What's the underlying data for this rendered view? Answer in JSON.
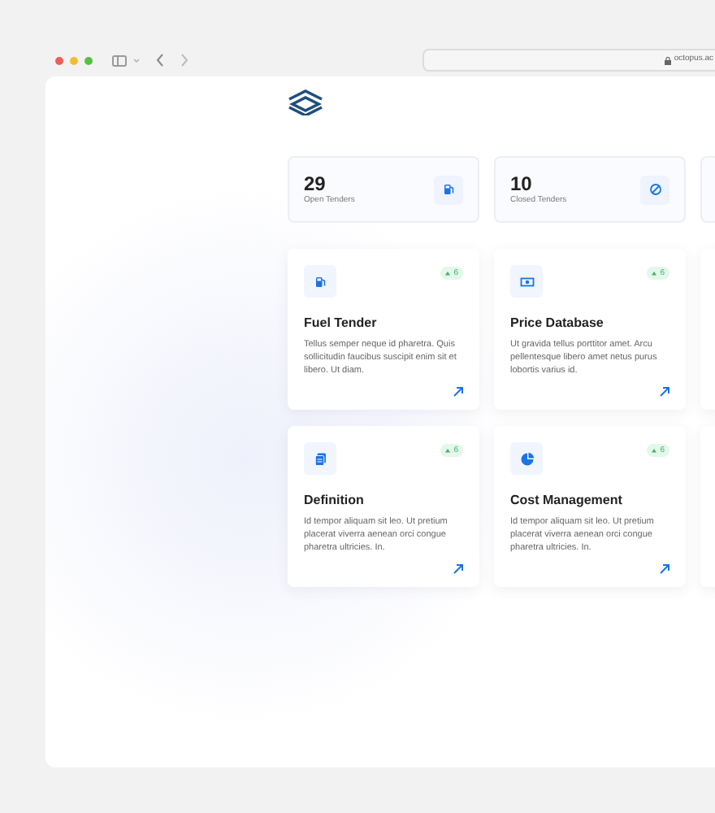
{
  "browser": {
    "address": "octopus.ac"
  },
  "stats": [
    {
      "value": "29",
      "label": "Open Tenders"
    },
    {
      "value": "10",
      "label": "Closed Tenders"
    }
  ],
  "modules": [
    {
      "title": "Fuel Tender",
      "description": "Tellus semper neque id pharetra. Quis sollicitudin faucibus suscipit enim sit et libero. Ut diam.",
      "badge": "6"
    },
    {
      "title": "Price Database",
      "description": "Ut gravida tellus porttitor amet. Arcu pellentesque libero amet netus purus lobortis varius id.",
      "badge": "6"
    },
    {
      "title": "Definition",
      "description": "Id tempor aliquam sit leo. Ut pretium placerat viverra aenean orci congue pharetra ultricies. In.",
      "badge": "6"
    },
    {
      "title": "Cost Management",
      "description": "Id tempor aliquam sit leo. Ut pretium placerat viverra aenean orci congue pharetra ultricies. In.",
      "badge": "6"
    }
  ]
}
